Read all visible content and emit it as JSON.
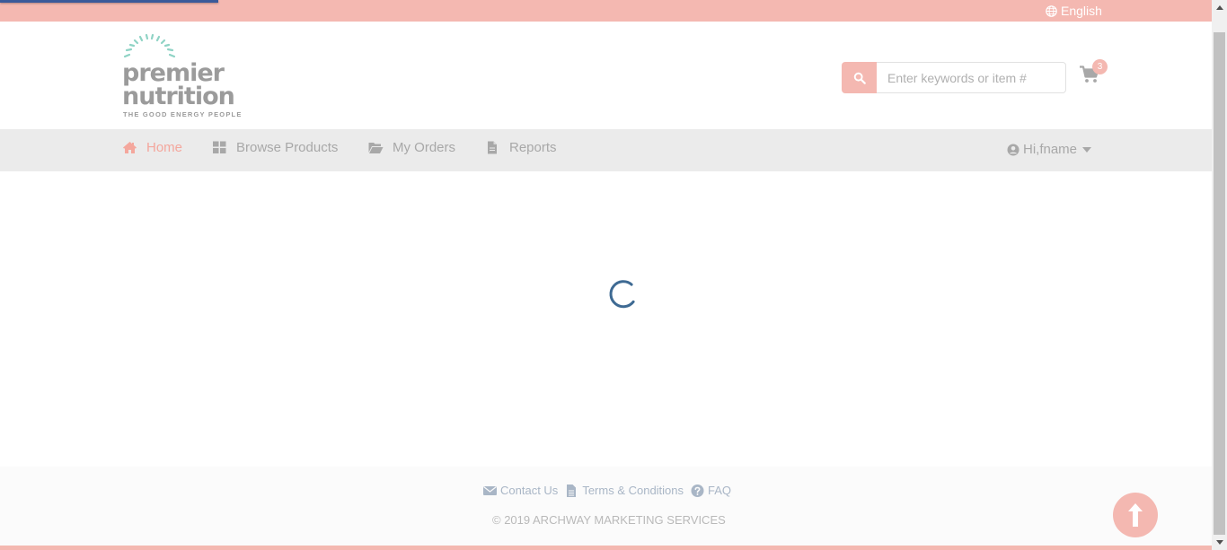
{
  "topbar": {
    "language_label": "English"
  },
  "brand": {
    "word1": "premier",
    "word2": "nutrition",
    "tagline": "THE GOOD ENERGY PEOPLE"
  },
  "search": {
    "placeholder": "Enter keywords or item #"
  },
  "cart": {
    "count": "3"
  },
  "nav": {
    "items": [
      {
        "label": "Home",
        "icon": "home-icon",
        "active": true
      },
      {
        "label": "Browse Products",
        "icon": "grid-icon",
        "active": false
      },
      {
        "label": "My Orders",
        "icon": "folder-open-icon",
        "active": false
      },
      {
        "label": "Reports",
        "icon": "file-icon",
        "active": false
      }
    ],
    "user_greeting": "Hi,fname"
  },
  "main": {
    "state": "loading"
  },
  "footer": {
    "links": [
      {
        "label": "Contact Us",
        "icon": "envelope-icon"
      },
      {
        "label": "Terms & Conditions",
        "icon": "file-text-icon"
      },
      {
        "label": "FAQ",
        "icon": "question-circle-icon"
      }
    ],
    "copyright": "© 2019 ARCHWAY MARKETING SERVICES"
  },
  "colors": {
    "accent": "#f4b8b1",
    "nav_bg": "#ebebeb",
    "spinner": "#3e6a93",
    "footer_link": "#a9b6c6"
  }
}
